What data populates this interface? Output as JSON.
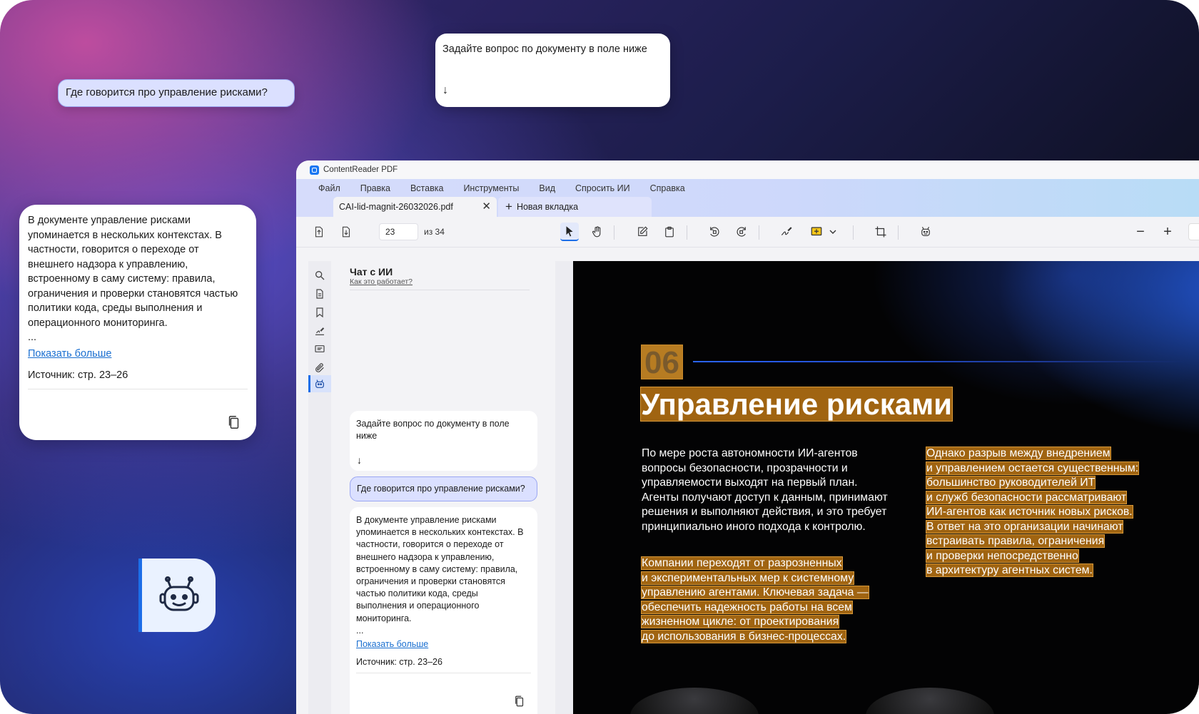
{
  "floating": {
    "prompt_text": "Задайте вопрос по документу в поле ниже",
    "prompt_arrow": "↓",
    "question": "Где говорится про управление рисками?",
    "answer_text": "В документе управление рисками упоминается в нескольких контекстах. В частности, говорится о переходе от внешнего надзора к управлению, встроенному в саму систему: правила, ограничения и проверки становятся частью политики кода, среды выполнения и операционного мониторинга.",
    "ellipsis": "...",
    "show_more": "Показать больше",
    "source": "Источник: стр. 23–26",
    "robot_icon": "robot-icon"
  },
  "app": {
    "title": "ContentReader PDF",
    "menu": [
      "Файл",
      "Правка",
      "Вставка",
      "Инструменты",
      "Вид",
      "Спросить ИИ",
      "Справка"
    ],
    "tabs": {
      "doc": "CAI-lid-magnit-26032026.pdf",
      "new": "Новая вкладка",
      "close_glyph": "✕",
      "plus_glyph": "+"
    },
    "toolbar": {
      "page": "23",
      "total": "из 34",
      "zoom_out": "−",
      "zoom_in": "+"
    }
  },
  "chat": {
    "title": "Чат с ИИ",
    "help": "Как это работает?",
    "prompt_text": "Задайте вопрос по документу в поле ниже",
    "prompt_arrow": "↓",
    "question": "Где говорится про управление рисками?",
    "answer_text": "В документе управление рисками упоминается в нескольких контекстах. В частности, говорится о переходе от внешнего надзора к управлению, встроенному в саму систему: правила, ограничения и проверки становятся частью политики кода, среды выполнения и операционного мониторинга.",
    "ellipsis": "...",
    "show_more": "Показать больше",
    "source": "Источник: стр. 23–26"
  },
  "document": {
    "section_number": "06",
    "section_title": "Управление рисками",
    "paragraph1": "По мере роста автономности ИИ-агентов вопросы безопасности, прозрачности и управляемости выходят на первый план. Агенты получают доступ к данным, принимают решения и выполняют действия, и это требует принципиально иного подхода к контролю.",
    "paragraph2_lines": [
      "Компании переходят от разрозненных",
      "и экспериментальных мер к системному",
      "управлению агентами. Ключевая задача —",
      "обеспечить надежность работы на всем",
      "жизненном цикле: от проектирования",
      "до использования в бизнес-процессах."
    ],
    "paragraph3_lines": [
      "Однако разрыв между внедрением",
      "и управлением остается существенным:",
      "большинство руководителей ИТ",
      "и служб безопасности рассматривают",
      "ИИ-агентов как источник новых рисков.",
      "В ответ на это организации начинают",
      "встраивать правила, ограничения",
      "и проверки непосредственно",
      "в архитектуру агентных систем."
    ]
  },
  "colors": {
    "accent": "#1c6ee8",
    "highlight": "#cd8016",
    "question_bg": "#dbe0ff"
  }
}
